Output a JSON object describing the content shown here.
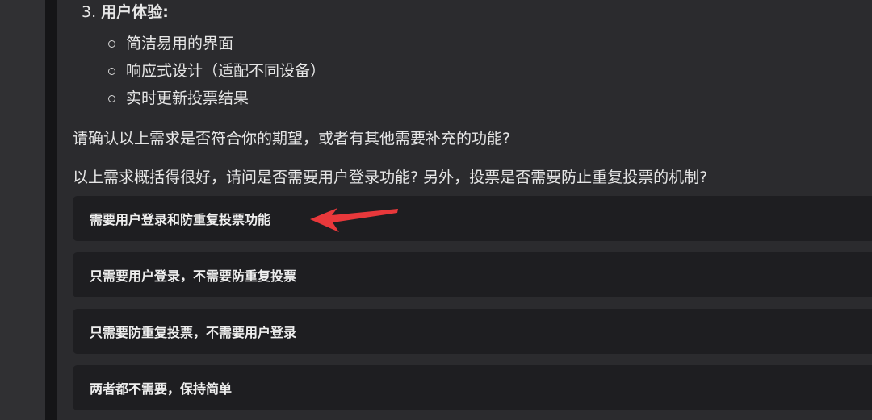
{
  "section": {
    "number": "3.",
    "title": "用户体验:",
    "items": [
      "简洁易用的界面",
      "响应式设计（适配不同设备）",
      "实时更新投票结果"
    ]
  },
  "confirm_prompt": "请确认以上需求是否符合你的期望，或者有其他需要补充的功能?",
  "follow_up_question": "以上需求概括得很好，请问是否需要用户登录功能? 另外，投票是否需要防止重复投票的机制?",
  "options": [
    "需要用户登录和防重复投票功能",
    "只需要用户登录，不需要防重复投票",
    "只需要防重复投票，不需要用户登录",
    "两者都不需要，保持简单"
  ],
  "colors": {
    "page_bg": "#2b2b2e",
    "option_bg": "#1e1e21",
    "annotation_arrow": "#e8383b"
  }
}
